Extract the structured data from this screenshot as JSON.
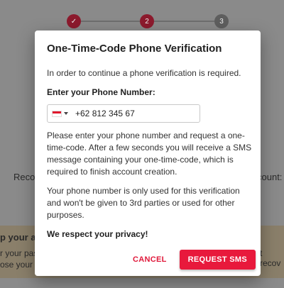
{
  "background": {
    "steps": [
      {
        "label": "✓"
      },
      {
        "label": "2"
      },
      {
        "label": "3"
      }
    ],
    "text_left": "Reco",
    "text_right": "count:",
    "warning": {
      "title": "p your ac",
      "line1": "r your pass",
      "line1_right": "t recov",
      "line2": "ose your pa"
    }
  },
  "dialog": {
    "title": "One-Time-Code Phone Verification",
    "intro": "In order to continue a phone verification is required.",
    "phone_label": "Enter your Phone Number:",
    "phone_value": "+62 812 345 67",
    "instructions": "Please enter your phone number and request a one-time-code. After a few seconds you will receive a SMS message containing your one-time-code, which is required to finish account creation.",
    "privacy_note": "Your phone number is only used for this verification and won't be given to 3rd parties or used for other purposes.",
    "privacy_respect": "We respect your privacy!",
    "cancel_label": "CANCEL",
    "request_label": "REQUEST SMS"
  },
  "colors": {
    "accent": "#e8193c",
    "flag_red": "#e0182d",
    "flag_white": "#ffffff"
  },
  "icons": {
    "country": "indonesia-flag-icon",
    "dropdown": "caret-down-icon",
    "step_done": "checkmark-icon"
  }
}
